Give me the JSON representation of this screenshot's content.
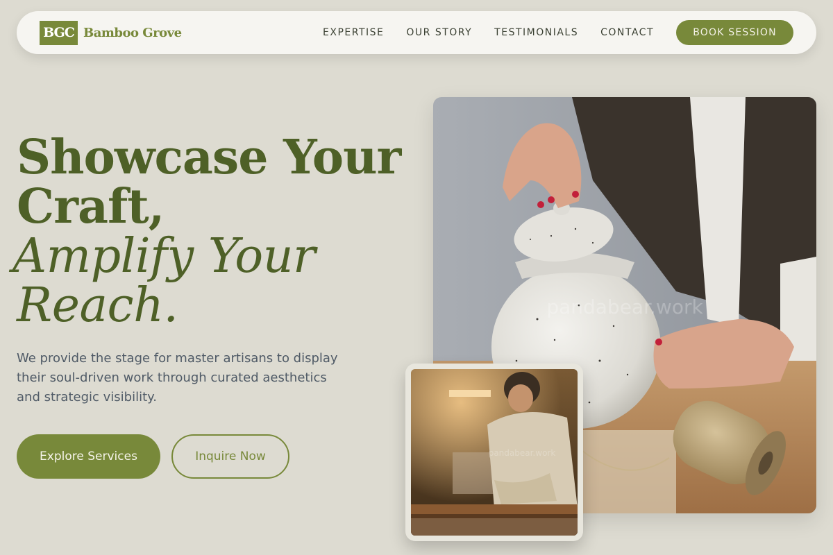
{
  "nav": {
    "logo_mark": "BGC",
    "brand_name": "Bamboo Grove",
    "links": [
      "EXPERTISE",
      "OUR STORY",
      "TESTIMONIALS",
      "CONTACT"
    ],
    "cta_label": "BOOK SESSION"
  },
  "hero": {
    "headline_line1": "Showcase Your",
    "headline_line2": "Craft,",
    "headline_italic_line1": "Amplify Your",
    "headline_italic_line2": "Reach.",
    "description": "We provide the stage for master artisans to display their soul-driven work through curated aesthetics and strategic visibility.",
    "primary_button": "Explore Services",
    "secondary_button": "Inquire Now"
  },
  "images": {
    "main_watermark": "pandabear.work",
    "thumb_watermark": "pandabear.work"
  },
  "colors": {
    "accent": "#78893a",
    "headline": "#4e6027",
    "background": "#dddbd1",
    "nav_bg": "#f6f5f1",
    "body_text": "#4f5a66"
  }
}
